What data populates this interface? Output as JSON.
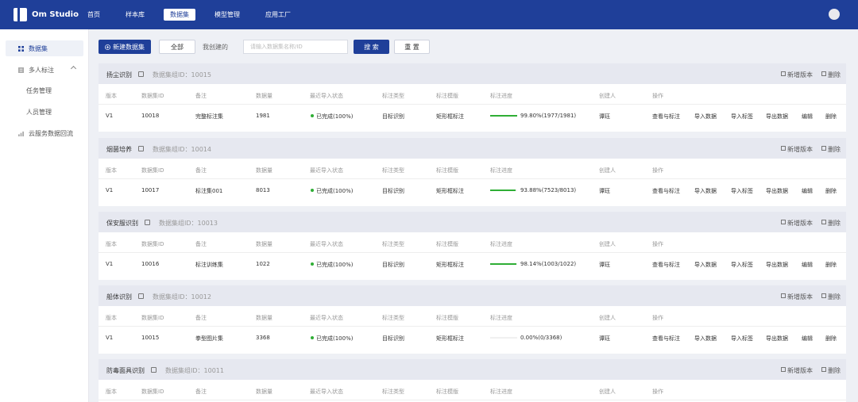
{
  "app": {
    "name": "Om Studio"
  },
  "nav": {
    "items": [
      "首页",
      "样本库",
      "数据集",
      "模型管理",
      "应用工厂"
    ],
    "active": 2
  },
  "sidebar": {
    "items": [
      {
        "label": "数据集",
        "icon": "grid-icon",
        "active": true
      },
      {
        "label": "多人标注",
        "icon": "list-icon",
        "expanded": true,
        "children": [
          "任务管理",
          "人员管理"
        ]
      },
      {
        "label": "云服务数据回流",
        "icon": "chart-icon"
      }
    ]
  },
  "toolbar": {
    "new_dataset": "新建数据集",
    "filter_all": "全部",
    "filter_mine": "我创建的",
    "search_placeholder": "请输入数据集名称/ID",
    "search_button": "搜 索",
    "reset_button": "重 置"
  },
  "columns": [
    "版本",
    "数据集ID",
    "备注",
    "数据量",
    "最近导入状态",
    "标注类型",
    "标注模版",
    "标注进度",
    "创建人",
    "操作"
  ],
  "group_id_label": "数据集组ID：",
  "group_actions": {
    "new_version": "新增版本",
    "delete": "删除"
  },
  "row_actions": [
    "查看与标注",
    "导入数据",
    "导入标签",
    "导出数据",
    "编辑",
    "删除"
  ],
  "groups": [
    {
      "name": "扬尘识别",
      "group_id": "10015",
      "row": {
        "version": "V1",
        "dataset_id": "10018",
        "note": "完整标注集",
        "count": "1981",
        "import_status": "已完成(100%)",
        "label_type": "目标识别",
        "template": "矩形框标注",
        "progress_text": "99.80%(1977/1981)",
        "progress": 0.998,
        "creator": "谭珏"
      }
    },
    {
      "name": "烟菌培养",
      "group_id": "10014",
      "row": {
        "version": "V1",
        "dataset_id": "10017",
        "note": "标注集001",
        "count": "8013",
        "import_status": "已完成(100%)",
        "label_type": "目标识别",
        "template": "矩形框标注",
        "progress_text": "93.88%(7523/8013)",
        "progress": 0.9388,
        "creator": "谭珏"
      }
    },
    {
      "name": "保安服识别",
      "group_id": "10013",
      "row": {
        "version": "V1",
        "dataset_id": "10016",
        "note": "标注训练集",
        "count": "1022",
        "import_status": "已完成(100%)",
        "label_type": "目标识别",
        "template": "矩形框标注",
        "progress_text": "98.14%(1003/1022)",
        "progress": 0.9814,
        "creator": "谭珏"
      }
    },
    {
      "name": "船体识别",
      "group_id": "10012",
      "row": {
        "version": "V1",
        "dataset_id": "10015",
        "note": "拳型图片集",
        "count": "3368",
        "import_status": "已完成(100%)",
        "label_type": "目标识别",
        "template": "矩形框标注",
        "progress_text": "0.00%(0/3368)",
        "progress": 0,
        "creator": "谭珏"
      }
    },
    {
      "name": "防毒面具识别",
      "group_id": "10011",
      "row": null
    }
  ],
  "colors": {
    "primary": "#1f3f99",
    "success": "#2fae35",
    "group_header": "#e6e8f0"
  }
}
